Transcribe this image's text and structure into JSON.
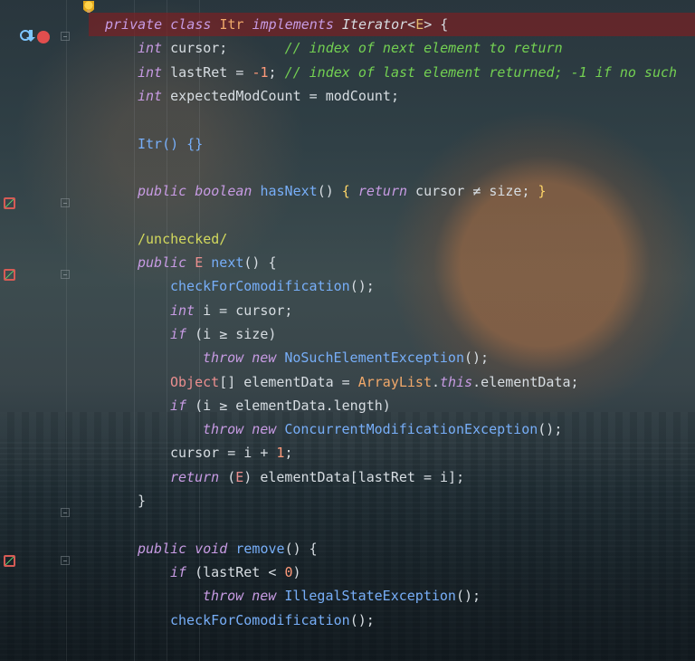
{
  "editor": {
    "lines": [
      {
        "id": "line-private-class",
        "highlight": true,
        "indent": 0,
        "tokens": [
          {
            "text": "private",
            "kind": "kw"
          },
          {
            "text": " ",
            "kind": "punc"
          },
          {
            "text": "class",
            "kind": "kw"
          },
          {
            "text": " ",
            "kind": "punc"
          },
          {
            "text": "Itr",
            "kind": "name"
          },
          {
            "text": " ",
            "kind": "punc"
          },
          {
            "text": "implements",
            "kind": "kw"
          },
          {
            "text": " ",
            "kind": "punc"
          },
          {
            "text": "Iterator",
            "kind": "iface"
          },
          {
            "text": "<",
            "kind": "punc"
          },
          {
            "text": "E",
            "kind": "generic"
          },
          {
            "text": "> {",
            "kind": "punc"
          }
        ]
      },
      {
        "id": "line-cursor",
        "indent": 1,
        "tokens": [
          {
            "text": "int",
            "kind": "kw"
          },
          {
            "text": " cursor;       ",
            "kind": "field"
          },
          {
            "text": "// index of next element to return",
            "kind": "comment"
          }
        ]
      },
      {
        "id": "line-lastret",
        "indent": 1,
        "tokens": [
          {
            "text": "int",
            "kind": "kw"
          },
          {
            "text": " lastRet = ",
            "kind": "field"
          },
          {
            "text": "-1",
            "kind": "num"
          },
          {
            "text": "; ",
            "kind": "punc"
          },
          {
            "text": "// index of last element returned; -1 if no such",
            "kind": "comment"
          }
        ]
      },
      {
        "id": "line-expectedmodcount",
        "indent": 1,
        "tokens": [
          {
            "text": "int",
            "kind": "kw"
          },
          {
            "text": " expectedModCount = modCount;",
            "kind": "field"
          }
        ]
      },
      {
        "id": "line-blank-1",
        "indent": 0,
        "tokens": []
      },
      {
        "id": "line-constructor",
        "indent": 1,
        "tokens": [
          {
            "text": "Itr",
            "kind": "fn"
          },
          {
            "text": "() {}",
            "kind": "fn"
          }
        ]
      },
      {
        "id": "line-blank-2",
        "indent": 0,
        "tokens": []
      },
      {
        "id": "line-hasnext",
        "indent": 1,
        "tokens": [
          {
            "text": "public",
            "kind": "kw"
          },
          {
            "text": " ",
            "kind": "punc"
          },
          {
            "text": "boolean",
            "kind": "kw"
          },
          {
            "text": " ",
            "kind": "punc"
          },
          {
            "text": "hasNext",
            "kind": "fn"
          },
          {
            "text": "() ",
            "kind": "punc"
          },
          {
            "text": "{",
            "kind": "brace"
          },
          {
            "text": " ",
            "kind": "punc"
          },
          {
            "text": "return",
            "kind": "kw"
          },
          {
            "text": " cursor ",
            "kind": "field"
          },
          {
            "text": "≠",
            "kind": "field"
          },
          {
            "text": " size; ",
            "kind": "field"
          },
          {
            "text": "}",
            "kind": "brace"
          }
        ]
      },
      {
        "id": "line-blank-3",
        "indent": 0,
        "tokens": []
      },
      {
        "id": "line-unchecked",
        "indent": 1,
        "tokens": [
          {
            "text": "/unchecked/",
            "kind": "ann"
          }
        ]
      },
      {
        "id": "line-next",
        "indent": 1,
        "tokens": [
          {
            "text": "public",
            "kind": "kw"
          },
          {
            "text": " ",
            "kind": "punc"
          },
          {
            "text": "E",
            "kind": "cls"
          },
          {
            "text": " ",
            "kind": "punc"
          },
          {
            "text": "next",
            "kind": "fn"
          },
          {
            "text": "() {",
            "kind": "punc"
          }
        ]
      },
      {
        "id": "line-checkforcomodification-1",
        "indent": 2,
        "tokens": [
          {
            "text": "checkForComodification",
            "kind": "fn"
          },
          {
            "text": "();",
            "kind": "punc"
          }
        ]
      },
      {
        "id": "line-int-i",
        "indent": 2,
        "tokens": [
          {
            "text": "int",
            "kind": "kw"
          },
          {
            "text": " i = cursor;",
            "kind": "field"
          }
        ]
      },
      {
        "id": "line-if-size",
        "indent": 2,
        "tokens": [
          {
            "text": "if",
            "kind": "kw"
          },
          {
            "text": " (i ",
            "kind": "punc"
          },
          {
            "text": "≥",
            "kind": "field"
          },
          {
            "text": " size)",
            "kind": "field"
          }
        ]
      },
      {
        "id": "line-throw-nosuch",
        "indent": 3,
        "tokens": [
          {
            "text": "throw",
            "kind": "kw"
          },
          {
            "text": " ",
            "kind": "punc"
          },
          {
            "text": "new",
            "kind": "kw"
          },
          {
            "text": " ",
            "kind": "punc"
          },
          {
            "text": "NoSuchElementException",
            "kind": "fn"
          },
          {
            "text": "();",
            "kind": "punc"
          }
        ]
      },
      {
        "id": "line-object-array",
        "indent": 2,
        "tokens": [
          {
            "text": "Object",
            "kind": "cls"
          },
          {
            "text": "[] elementData = ",
            "kind": "field"
          },
          {
            "text": "ArrayList",
            "kind": "name"
          },
          {
            "text": ".",
            "kind": "punc"
          },
          {
            "text": "this",
            "kind": "kw"
          },
          {
            "text": ".elementData;",
            "kind": "field"
          }
        ]
      },
      {
        "id": "line-if-length",
        "indent": 2,
        "tokens": [
          {
            "text": "if",
            "kind": "kw"
          },
          {
            "text": " (i ",
            "kind": "punc"
          },
          {
            "text": "≥",
            "kind": "field"
          },
          {
            "text": " elementData.length)",
            "kind": "field"
          }
        ]
      },
      {
        "id": "line-throw-concurrent",
        "indent": 3,
        "tokens": [
          {
            "text": "throw",
            "kind": "kw"
          },
          {
            "text": " ",
            "kind": "punc"
          },
          {
            "text": "new",
            "kind": "kw"
          },
          {
            "text": " ",
            "kind": "punc"
          },
          {
            "text": "ConcurrentModificationException",
            "kind": "fn"
          },
          {
            "text": "();",
            "kind": "punc"
          }
        ]
      },
      {
        "id": "line-cursor-plus",
        "indent": 2,
        "tokens": [
          {
            "text": "cursor = i + ",
            "kind": "field"
          },
          {
            "text": "1",
            "kind": "num"
          },
          {
            "text": ";",
            "kind": "punc"
          }
        ]
      },
      {
        "id": "line-return",
        "indent": 2,
        "tokens": [
          {
            "text": "return",
            "kind": "kw"
          },
          {
            "text": " (",
            "kind": "punc"
          },
          {
            "text": "E",
            "kind": "cls"
          },
          {
            "text": ") elementData[lastRet = i];",
            "kind": "field"
          }
        ]
      },
      {
        "id": "line-close-next",
        "indent": 1,
        "tokens": [
          {
            "text": "}",
            "kind": "punc"
          }
        ]
      },
      {
        "id": "line-blank-4",
        "indent": 0,
        "tokens": []
      },
      {
        "id": "line-remove",
        "indent": 1,
        "tokens": [
          {
            "text": "public",
            "kind": "kw"
          },
          {
            "text": " ",
            "kind": "punc"
          },
          {
            "text": "void",
            "kind": "kw"
          },
          {
            "text": " ",
            "kind": "punc"
          },
          {
            "text": "remove",
            "kind": "fn"
          },
          {
            "text": "() {",
            "kind": "punc"
          }
        ]
      },
      {
        "id": "line-if-lastret",
        "indent": 2,
        "tokens": [
          {
            "text": "if",
            "kind": "kw"
          },
          {
            "text": " (lastRet < ",
            "kind": "punc"
          },
          {
            "text": "0",
            "kind": "num"
          },
          {
            "text": ")",
            "kind": "punc"
          }
        ]
      },
      {
        "id": "line-throw-illegal",
        "indent": 3,
        "tokens": [
          {
            "text": "throw",
            "kind": "kw"
          },
          {
            "text": " ",
            "kind": "punc"
          },
          {
            "text": "new",
            "kind": "kw"
          },
          {
            "text": " ",
            "kind": "punc"
          },
          {
            "text": "IllegalStateException",
            "kind": "fn"
          },
          {
            "text": "();",
            "kind": "punc"
          }
        ]
      },
      {
        "id": "line-checkforcomodification-2",
        "indent": 2,
        "tokens": [
          {
            "text": "checkForComodification",
            "kind": "fn"
          },
          {
            "text": "();",
            "kind": "punc"
          }
        ]
      }
    ],
    "gutter_icons": [
      {
        "line": 0,
        "name": "bulb-icon"
      },
      {
        "line": 1,
        "name": "run-icon"
      },
      {
        "line": 1,
        "name": "arrow-down-icon"
      },
      {
        "line": 1,
        "name": "breakpoint-icon"
      },
      {
        "line": 1,
        "name": "fold-icon"
      },
      {
        "line": 8,
        "name": "debug-icon"
      },
      {
        "line": 8,
        "name": "fold-icon"
      },
      {
        "line": 11,
        "name": "debug-icon"
      },
      {
        "line": 11,
        "name": "fold-icon"
      },
      {
        "line": 21,
        "name": "fold-icon"
      },
      {
        "line": 23,
        "name": "debug-icon"
      },
      {
        "line": 23,
        "name": "fold-icon"
      }
    ]
  }
}
